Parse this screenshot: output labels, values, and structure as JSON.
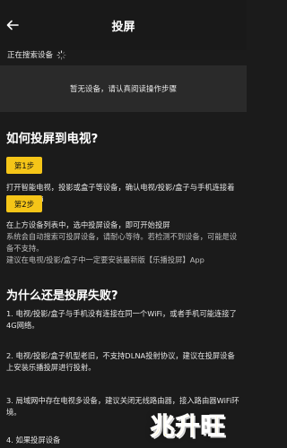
{
  "header": {
    "title": "投屏",
    "back_icon": "arrow-left-icon"
  },
  "search": {
    "status_label": "正在搜索设备",
    "spinner_icon": "loading-spinner-icon"
  },
  "device_list": {
    "empty_message": "暂无设备，请认真阅读操作步骤"
  },
  "guide": {
    "title": "如何投屏到电视?",
    "step1_label": "第1步",
    "step1_text": "打开智能电视，投影或盒子等设备，确认电视/投影/盒子与手机连接着同一个WiFi",
    "step2_label": "第2步",
    "step2_text_a": "在上方设备列表中，选中投屏设备，即可开始投屏",
    "step2_text_b": "系统会自动搜索可投屏设备，请耐心等待。若检测不到设备，可能是设备不支持。",
    "step2_text_c": "建议在电视/投影/盒子中一定要安装最新版【乐播投屏】App"
  },
  "faq": {
    "title": "为什么还是投屏失败?",
    "reason1": "1. 电视/投影/盒子与手机没有连接在同一个WiFi，或者手机可能连接了4G网络。",
    "reason2": "2. 电视/投影/盒子机型老旧，不支持DLNA投射协议，建议在投屏设备上安装乐播投屏进行投射。",
    "reason3": "3. 局域网中存在电视多设备，建议关闭无线路由器，接入路由器WiFi环境。",
    "reason4": "4. 如果投屏设备"
  },
  "watermark": {
    "text": "兆升旺"
  },
  "colors": {
    "background": "#1b1b1b",
    "panel": "#2a2a2a",
    "accent": "#f5c518"
  }
}
